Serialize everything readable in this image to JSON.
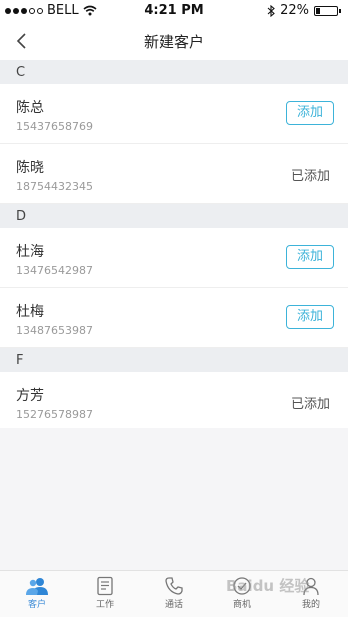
{
  "status_bar": {
    "carrier": "BELL",
    "time": "4:21 PM",
    "battery": "22%",
    "battery_level": 0.22
  },
  "nav": {
    "title": "新建客户"
  },
  "sections": [
    {
      "letter": "C",
      "contacts": [
        {
          "name": "陈总",
          "phone": "15437658769",
          "action": "添加",
          "added": false
        },
        {
          "name": "陈晓",
          "phone": "18754432345",
          "action": "已添加",
          "added": true
        }
      ]
    },
    {
      "letter": "D",
      "contacts": [
        {
          "name": "杜海",
          "phone": "13476542987",
          "action": "添加",
          "added": false
        },
        {
          "name": "杜梅",
          "phone": "13487653987",
          "action": "添加",
          "added": false
        }
      ]
    },
    {
      "letter": "F",
      "contacts": [
        {
          "name": "方芳",
          "phone": "15276578987",
          "action": "已添加",
          "added": true
        }
      ]
    }
  ],
  "tabs": [
    {
      "label": "客户",
      "icon": "people-icon",
      "active": true
    },
    {
      "label": "工作",
      "icon": "document-icon",
      "active": false
    },
    {
      "label": "通话",
      "icon": "phone-icon",
      "active": false
    },
    {
      "label": "商机",
      "icon": "opportunity-icon",
      "active": false
    },
    {
      "label": "我的",
      "icon": "profile-icon",
      "active": false
    }
  ],
  "watermark": "Baidu 经验",
  "colors": {
    "accent": "#3db3d9",
    "tab_active": "#3a8ad6",
    "section_bg": "#eceef1"
  }
}
